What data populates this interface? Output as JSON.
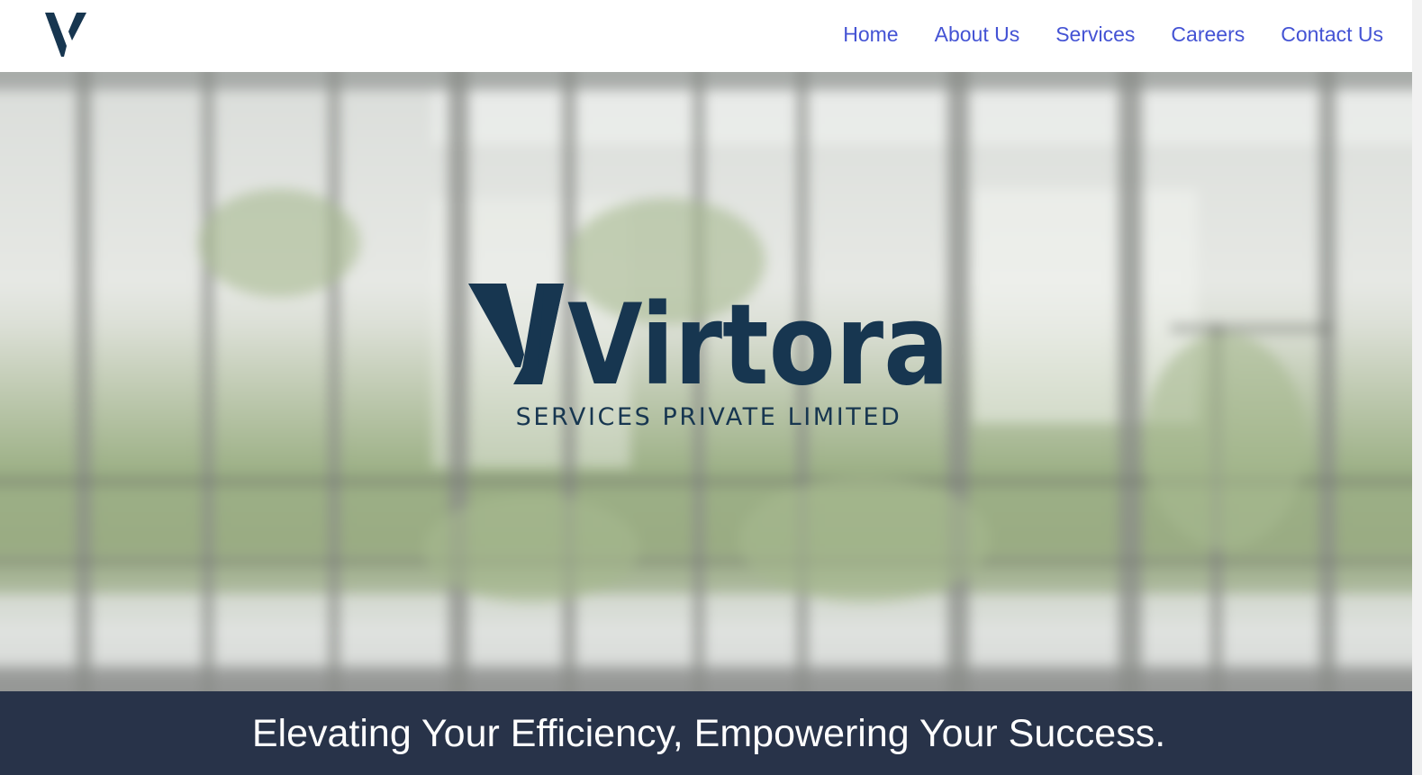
{
  "brand": {
    "logo_mark_icon": "virtora-v-logo-icon",
    "logo_wordmark": "Virtora",
    "subtitle": "SERVICES PRIVATE LIMITED",
    "primary_color": "#173650"
  },
  "nav": {
    "items": [
      {
        "label": "Home"
      },
      {
        "label": "About Us"
      },
      {
        "label": "Services"
      },
      {
        "label": "Careers"
      },
      {
        "label": "Contact Us"
      }
    ],
    "link_color": "#4453d4"
  },
  "hero": {
    "background": "blurred-office-glass-wall-photo"
  },
  "tagline": {
    "text": "Elevating Your Efficiency, Empowering Your Success.",
    "band_color": "#283349"
  }
}
